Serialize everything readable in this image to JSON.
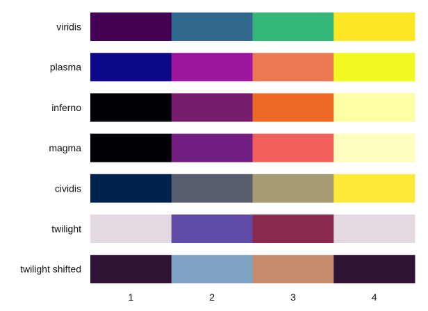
{
  "chart_data": {
    "type": "heatmap",
    "title": "",
    "xlabel": "",
    "ylabel": "",
    "x": [
      "1",
      "2",
      "3",
      "4"
    ],
    "rows": [
      {
        "name": "viridis",
        "colors": [
          "#440154",
          "#31688e",
          "#35b779",
          "#fde725"
        ]
      },
      {
        "name": "plasma",
        "colors": [
          "#0d0887",
          "#9c179e",
          "#ed7953",
          "#f0f921"
        ]
      },
      {
        "name": "inferno",
        "colors": [
          "#000004",
          "#781c6d",
          "#ed6925",
          "#fcffa4"
        ]
      },
      {
        "name": "magma",
        "colors": [
          "#000004",
          "#721f81",
          "#f1605d",
          "#fcfdbf"
        ]
      },
      {
        "name": "cividis",
        "colors": [
          "#00224e",
          "#575d6d",
          "#a59c74",
          "#fee838"
        ]
      },
      {
        "name": "twilight",
        "colors": [
          "#e2d9e2",
          "#5f4ba5",
          "#8b2a4f",
          "#e2d9e2"
        ]
      },
      {
        "name": "twilight shifted",
        "colors": [
          "#2f1436",
          "#7ea3c4",
          "#c68a6f",
          "#2f1436"
        ]
      }
    ],
    "grid": false,
    "legend": "none"
  }
}
